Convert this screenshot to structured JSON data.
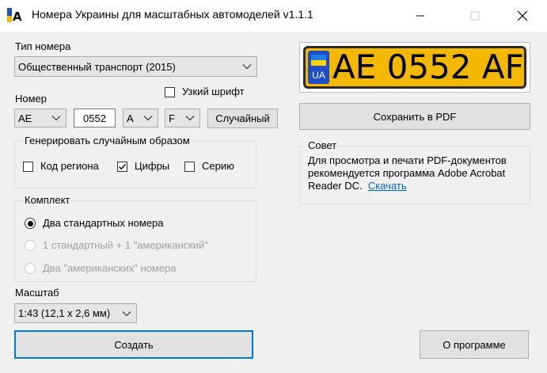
{
  "window": {
    "title": "Номера Украины для масштабных автомоделей v1.1.1",
    "minimize_icon": "minimize-icon",
    "maximize_icon": "maximize-icon",
    "close_icon": "close-icon"
  },
  "plate_type": {
    "label": "Тип номера",
    "selected": "Общественный транспорт (2015)"
  },
  "narrow_font": {
    "label": "Узкий шрифт",
    "checked": false
  },
  "number": {
    "label": "Номер",
    "region": "AE",
    "digits": "0552",
    "letter1": "A",
    "letter2": "F",
    "random_button": "Случайный"
  },
  "random_group": {
    "title": "Генерировать случайным образом",
    "region_code": {
      "label": "Код региона",
      "checked": false
    },
    "digits": {
      "label": "Цифры",
      "checked": true
    },
    "series": {
      "label": "Серию",
      "checked": false
    }
  },
  "kit_group": {
    "title": "Комплект",
    "options": [
      {
        "label": "Два стандартных номера",
        "selected": true,
        "enabled": true
      },
      {
        "label": "1 стандартный + 1 \"американский\"",
        "selected": false,
        "enabled": false
      },
      {
        "label": "Два \"американских\" номера",
        "selected": false,
        "enabled": false
      }
    ]
  },
  "scale": {
    "label": "Масштаб",
    "selected": "1:43 (12,1 x 2,6 мм)"
  },
  "buttons": {
    "create": "Создать",
    "about": "О программе",
    "save_pdf": "Сохранить в PDF"
  },
  "plate_preview": {
    "text": "AE 0552 AF",
    "country": "UA",
    "background_color": "#f5b800"
  },
  "tip": {
    "title": "Совет",
    "text": "Для просмотра и печати PDF-документов рекомендуется программа Adobe Acrobat Reader DC.",
    "link": "Скачать"
  },
  "colors": {
    "accent": "#0078d7",
    "link": "#0066cc"
  }
}
